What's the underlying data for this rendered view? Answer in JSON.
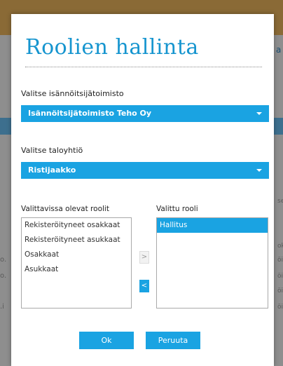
{
  "background": {
    "right_link_text": "a",
    "left_fragments": [
      "o.",
      "o.",
      ".i"
    ],
    "right_fragments": [
      "se",
      "ok",
      "öi",
      "öi",
      "öi",
      "öi"
    ]
  },
  "modal": {
    "title": "Roolien hallinta",
    "office": {
      "label": "Valitse isännöitsijätoimisto",
      "selected": "Isännöitsijätoimisto Teho Oy"
    },
    "company": {
      "label": "Valitse taloyhtiö",
      "selected": "Ristijaakko"
    },
    "available_roles": {
      "label": "Valittavissa olevat roolit",
      "items": [
        "Rekisteröityneet osakkaat",
        "Rekisteröityneet asukkaat",
        "Osakkaat",
        "Asukkaat"
      ]
    },
    "selected_roles": {
      "label": "Valittu rooli",
      "items": [
        "Hallitus"
      ]
    },
    "move_right_label": ">",
    "move_left_label": "<",
    "ok_label": "Ok",
    "cancel_label": "Peruuta"
  },
  "colors": {
    "accent": "#1aa3e2",
    "title": "#1695cf",
    "overlay": "#8e8e8e"
  }
}
